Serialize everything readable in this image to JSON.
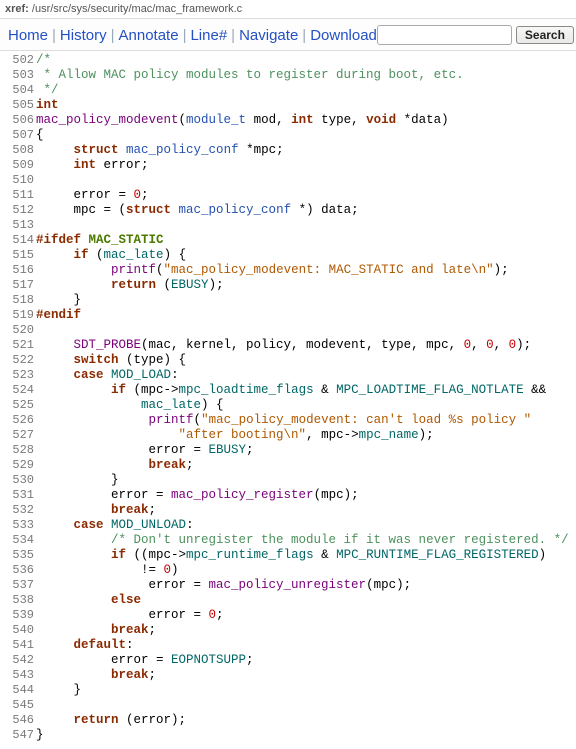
{
  "xref": {
    "label": "xref: ",
    "path": "/usr/src/sys/security/mac/mac_framework.c"
  },
  "nav": {
    "home": "Home",
    "history": "History",
    "annotate": "Annotate",
    "line": "Line#",
    "navigate": "Navigate",
    "download": "Download",
    "search_placeholder": "",
    "search_btn": "Search"
  },
  "lines": {
    "502": "/*",
    "503": " * Allow MAC policy modules to register during boot, etc.",
    "504": " */",
    "505_int": "int",
    "506_fn": "mac_policy_modevent",
    "506_sig_a": "(",
    "506_mod_t": "module_t",
    "506_mod": " mod, ",
    "506_int": "int",
    "506_type": " type, ",
    "506_void": "void",
    "506_tail": " *data)",
    "507": "{",
    "508_struct": "struct",
    "508_t": "mac_policy_conf",
    "508_tail": " *mpc;",
    "509_int": "int",
    "509_tail": " error;",
    "511_a": "     error = ",
    "511_zero": "0",
    "511_b": ";",
    "512_a": "     mpc = (",
    "512_struct": "struct",
    "512_sp": " ",
    "512_t": "mac_policy_conf",
    "512_b": " *) data;",
    "514_pre": "#ifdef ",
    "514_mac": "MAC_STATIC",
    "515_if": "if",
    "515_a": " (",
    "515_id": "mac_late",
    "515_b": ") {",
    "516_a": "          ",
    "516_fn": "printf",
    "516_b": "(",
    "516_str": "\"mac_policy_modevent: MAC_STATIC and late\\n\"",
    "516_c": ");",
    "517_a": "          ",
    "517_ret": "return",
    "517_b": " (",
    "517_id": "EBUSY",
    "517_c": ");",
    "518": "     }",
    "519": "#endif",
    "521_a": "     ",
    "521_fn": "SDT_PROBE",
    "521_b": "(mac, kernel, policy, modevent, type, mpc, ",
    "521_z1": "0",
    "521_c": ", ",
    "521_z2": "0",
    "521_d": ", ",
    "521_z3": "0",
    "521_e": ");",
    "522_a": "     ",
    "522_sw": "switch",
    "522_b": " (type) {",
    "523_a": "     ",
    "523_case": "case",
    "523_b": " ",
    "523_id": "MOD_LOAD",
    "523_c": ":",
    "524_a": "          ",
    "524_if": "if",
    "524_b": " (mpc->",
    "524_id": "mpc_loadtime_flags",
    "524_c": " & ",
    "524_id2": "MPC_LOADTIME_FLAG_NOTLATE",
    "524_d": " &&",
    "525_a": "              ",
    "525_id": "mac_late",
    "525_b": ") {",
    "526_a": "               ",
    "526_fn": "printf",
    "526_b": "(",
    "526_str": "\"mac_policy_modevent: can't load %s policy \"",
    "527_a": "                   ",
    "527_str": "\"after booting\\n\"",
    "527_b": ", mpc->",
    "527_id": "mpc_name",
    "527_c": ");",
    "528_a": "               error = ",
    "528_id": "EBUSY",
    "528_b": ";",
    "529_a": "               ",
    "529_br": "break",
    "529_b": ";",
    "530": "          }",
    "531_a": "          error = ",
    "531_fn": "mac_policy_register",
    "531_b": "(mpc);",
    "532_a": "          ",
    "532_br": "break",
    "532_b": ";",
    "533_a": "     ",
    "533_case": "case",
    "533_b": " ",
    "533_id": "MOD_UNLOAD",
    "533_c": ":",
    "534": "          /* Don't unregister the module if it was never registered. */",
    "535_a": "          ",
    "535_if": "if",
    "535_b": " ((mpc->",
    "535_id": "mpc_runtime_flags",
    "535_c": " & ",
    "535_id2": "MPC_RUNTIME_FLAG_REGISTERED",
    "535_d": ")",
    "536_a": "              != ",
    "536_z": "0",
    "536_b": ")",
    "537_a": "               error = ",
    "537_fn": "mac_policy_unregister",
    "537_b": "(mpc);",
    "538_a": "          ",
    "538_else": "else",
    "539_a": "               error = ",
    "539_z": "0",
    "539_b": ";",
    "540_a": "          ",
    "540_br": "break",
    "540_b": ";",
    "541_a": "     ",
    "541_def": "default",
    "541_b": ":",
    "542_a": "          error = ",
    "542_id": "EOPNOTSUPP",
    "542_b": ";",
    "543_a": "          ",
    "543_br": "break",
    "543_b": ";",
    "544": "     }",
    "546_a": "     ",
    "546_ret": "return",
    "546_b": " (error);",
    "547": "}"
  }
}
